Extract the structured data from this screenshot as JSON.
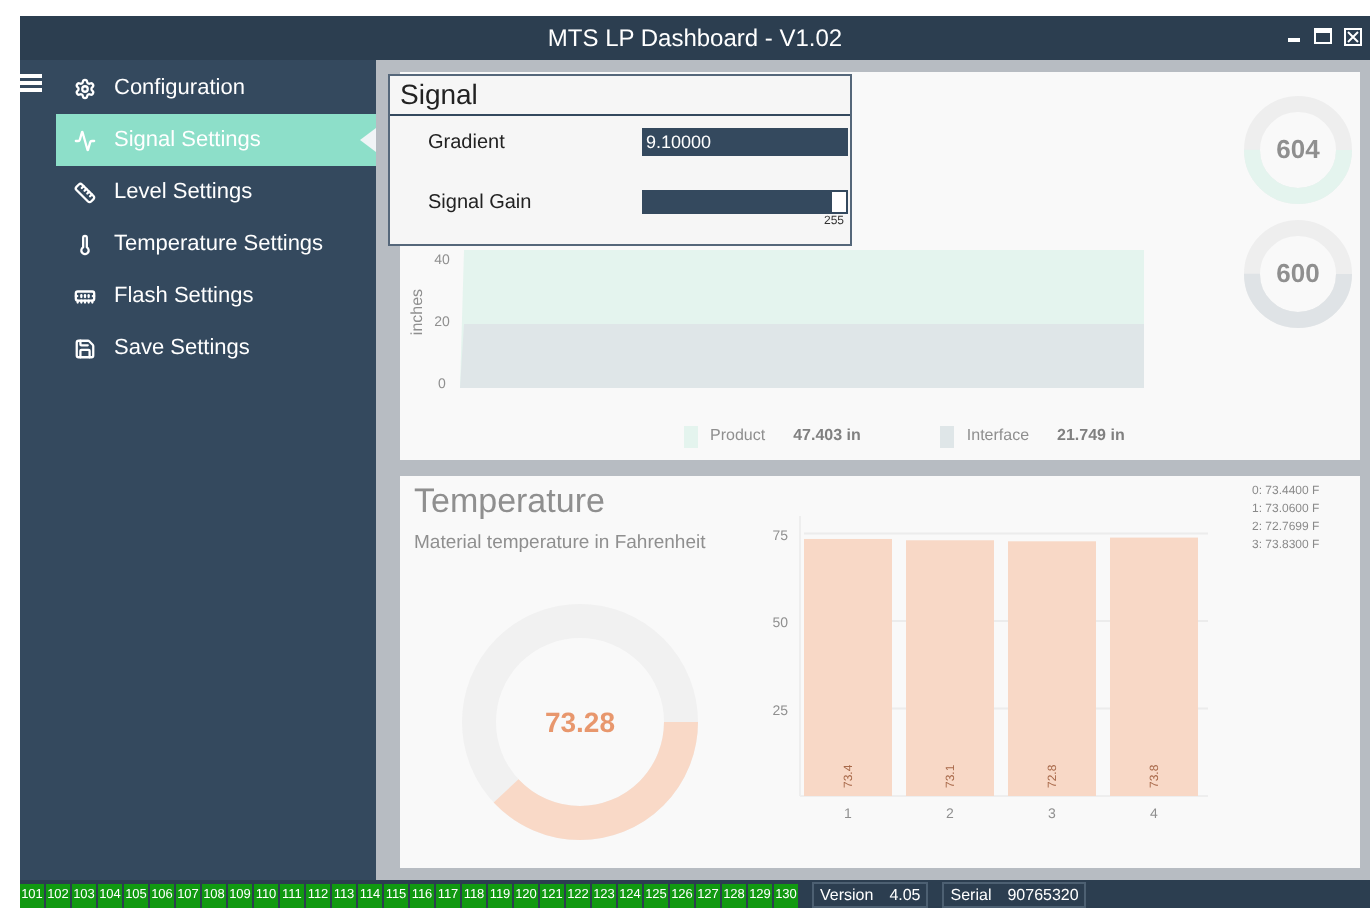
{
  "window": {
    "title": "MTS LP Dashboard - V1.02"
  },
  "sidebar": {
    "items": [
      {
        "label": "Configuration",
        "selected": false
      },
      {
        "label": "Signal Settings",
        "selected": true
      },
      {
        "label": "Level Settings",
        "selected": false
      },
      {
        "label": "Temperature Settings",
        "selected": false
      },
      {
        "label": "Flash Settings",
        "selected": false
      },
      {
        "label": "Save Settings",
        "selected": false
      }
    ]
  },
  "level_panel": {
    "chart": {
      "ylabel": "inches",
      "y_ticks": [
        "40",
        "20",
        "0"
      ]
    },
    "legend": [
      {
        "label": "Product",
        "value": "47.403 in",
        "color": "#e4f4ee"
      },
      {
        "label": "Interface",
        "value": "21.749 in",
        "color": "#dfe6e8"
      }
    ],
    "gauges": [
      {
        "value": "604",
        "level": 0.5,
        "color": "#e4f4ee"
      },
      {
        "value": "600",
        "level": 0.5,
        "color": "#dfe3e6"
      }
    ]
  },
  "temperature_panel": {
    "title": "Temperature",
    "subtitle": "Material temperature in Fahrenheit",
    "gauge": {
      "value": "73.28",
      "level": 0.38
    },
    "chart_data": {
      "type": "bar",
      "categories": [
        "1",
        "2",
        "3",
        "4"
      ],
      "values": [
        73.44,
        73.06,
        72.77,
        73.83
      ],
      "yticks": [
        25,
        50,
        75
      ],
      "ylim": [
        0,
        80
      ],
      "grid": true,
      "value_labels": [
        "73.4",
        "73.1",
        "72.8",
        "73.8"
      ]
    },
    "readings": [
      "0: 73.4400 F",
      "1: 73.0600 F",
      "2: 72.7699 F",
      "3: 73.8300 F"
    ]
  },
  "signal_dialog": {
    "title": "Signal",
    "gradient": {
      "label": "Gradient",
      "value": "9.10000"
    },
    "signal_gain": {
      "label": "Signal Gain",
      "level": 1,
      "reading": "255"
    }
  },
  "status_bar": {
    "channels": [
      "101",
      "102",
      "103",
      "104",
      "105",
      "106",
      "107",
      "108",
      "109",
      "110",
      "111",
      "112",
      "113",
      "114",
      "115",
      "116",
      "117",
      "118",
      "119",
      "120",
      "121",
      "122",
      "123",
      "124",
      "125",
      "126",
      "127",
      "128",
      "129",
      "130"
    ],
    "version": {
      "label": "Version",
      "value": "4.05"
    },
    "serial": {
      "label": "Serial",
      "value": "90765320"
    }
  }
}
